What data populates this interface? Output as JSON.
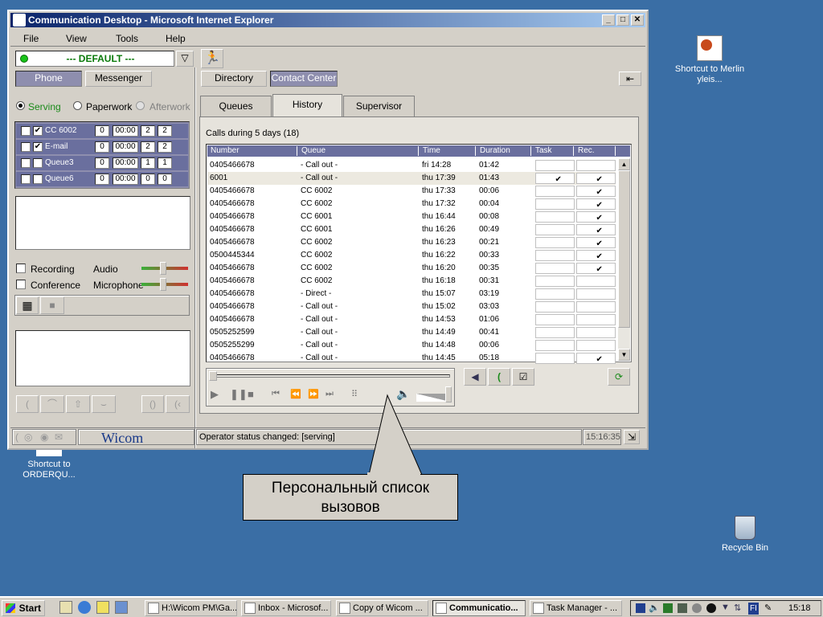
{
  "desktop": {
    "icons": [
      {
        "label": "Shortcut to Merlin yleis..."
      },
      {
        "label": "Shortcut to ORDERQU..."
      },
      {
        "label": "Recycle Bin"
      }
    ]
  },
  "window": {
    "title": "Communication Desktop - Microsoft Internet Explorer",
    "controls": {
      "minimize": "_",
      "maximize": "□",
      "close": "✕"
    }
  },
  "menu": [
    "File",
    "View",
    "Tools",
    "Help"
  ],
  "profile": {
    "name": "--- DEFAULT ---"
  },
  "left_tabs": {
    "phone": "Phone",
    "messenger": "Messenger"
  },
  "right_tabs": {
    "directory": "Directory",
    "contact_center": "Contact Center"
  },
  "status_options": {
    "serving": "Serving",
    "paperwork": "Paperwork",
    "afterwork": "Afterwork",
    "selected": "serving"
  },
  "queues": [
    {
      "name": "CC 6002",
      "checked": true,
      "a": "0",
      "time": "00:00",
      "b": "2",
      "c": "2"
    },
    {
      "name": "E-mail",
      "checked": true,
      "a": "0",
      "time": "00:00",
      "b": "2",
      "c": "2"
    },
    {
      "name": "Queue3",
      "checked": false,
      "a": "0",
      "time": "00:00",
      "b": "1",
      "c": "1"
    },
    {
      "name": "Queue6",
      "checked": false,
      "a": "0",
      "time": "00:00",
      "b": "0",
      "c": "0"
    }
  ],
  "controls": {
    "recording": "Recording",
    "conference": "Conference",
    "audio": "Audio",
    "microphone": "Microphone"
  },
  "view_tabs": {
    "queues": "Queues",
    "history": "History",
    "supervisor": "Supervisor",
    "active": "history"
  },
  "history": {
    "summary": "Calls during 5 days  (18)",
    "columns": [
      "Number",
      "Queue",
      "Time",
      "Duration",
      "Task",
      "Rec."
    ],
    "rows": [
      {
        "number": "0405466678",
        "queue": "- Call out -",
        "time": "fri 14:28",
        "duration": "01:42",
        "task": false,
        "rec": false
      },
      {
        "number": "6001",
        "queue": "- Call out -",
        "time": "thu 17:39",
        "duration": "01:43",
        "task": true,
        "rec": true
      },
      {
        "number": "0405466678",
        "queue": "CC 6002",
        "time": "thu 17:33",
        "duration": "00:06",
        "task": false,
        "rec": true
      },
      {
        "number": "0405466678",
        "queue": "CC 6002",
        "time": "thu 17:32",
        "duration": "00:04",
        "task": false,
        "rec": true
      },
      {
        "number": "0405466678",
        "queue": "CC 6001",
        "time": "thu 16:44",
        "duration": "00:08",
        "task": false,
        "rec": true
      },
      {
        "number": "0405466678",
        "queue": "CC 6001",
        "time": "thu 16:26",
        "duration": "00:49",
        "task": false,
        "rec": true
      },
      {
        "number": "0405466678",
        "queue": "CC 6002",
        "time": "thu 16:23",
        "duration": "00:21",
        "task": false,
        "rec": true
      },
      {
        "number": "0500445344",
        "queue": "CC 6002",
        "time": "thu 16:22",
        "duration": "00:33",
        "task": false,
        "rec": true
      },
      {
        "number": "0405466678",
        "queue": "CC 6002",
        "time": "thu 16:20",
        "duration": "00:35",
        "task": false,
        "rec": true
      },
      {
        "number": "0405466678",
        "queue": "CC 6002",
        "time": "thu 16:18",
        "duration": "00:31",
        "task": false,
        "rec": false
      },
      {
        "number": "0405466678",
        "queue": "- Direct -",
        "time": "thu 15:07",
        "duration": "03:19",
        "task": false,
        "rec": false
      },
      {
        "number": "0405466678",
        "queue": "- Call out -",
        "time": "thu 15:02",
        "duration": "03:03",
        "task": false,
        "rec": false
      },
      {
        "number": "0405466678",
        "queue": "- Call out -",
        "time": "thu 14:53",
        "duration": "01:06",
        "task": false,
        "rec": false
      },
      {
        "number": "0505252599",
        "queue": "- Call out -",
        "time": "thu 14:49",
        "duration": "00:41",
        "task": false,
        "rec": false
      },
      {
        "number": "0505255299",
        "queue": "- Call out -",
        "time": "thu 14:48",
        "duration": "00:06",
        "task": false,
        "rec": false
      },
      {
        "number": "0405466678",
        "queue": "- Call out -",
        "time": "thu 14:45",
        "duration": "05:18",
        "task": false,
        "rec": true
      }
    ]
  },
  "statusbar": {
    "brand": "Wicom",
    "message": "Operator status changed: [serving]",
    "clock": "15:16:35"
  },
  "callout": {
    "text": "Персональный список вызовов"
  },
  "taskbar": {
    "start": "Start",
    "tasks": [
      {
        "label": "H:\\Wicom PM\\Ga..."
      },
      {
        "label": "Inbox - Microsof..."
      },
      {
        "label": "Copy of Wicom ..."
      },
      {
        "label": "Communicatio...",
        "active": true
      },
      {
        "label": "Task Manager - ..."
      }
    ],
    "tray_lang": "FI",
    "clock": "15:18"
  }
}
